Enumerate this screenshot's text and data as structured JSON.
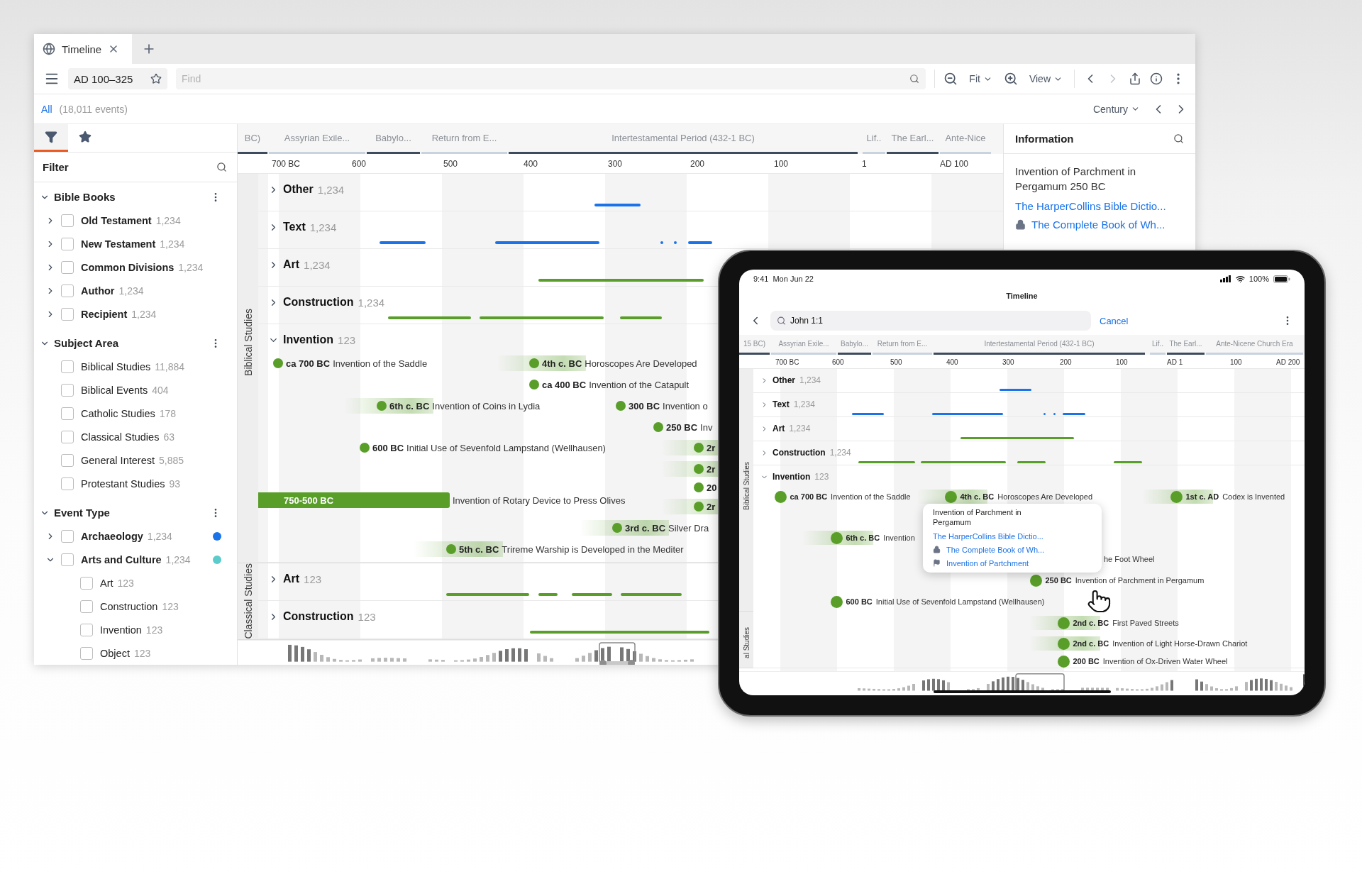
{
  "desktop": {
    "tab": {
      "title": "Timeline"
    },
    "toolbar": {
      "range": "AD 100–325",
      "find_placeholder": "Find",
      "fit": "Fit",
      "view": "View"
    },
    "scope": {
      "filter": "All",
      "count": "(18,011 events)",
      "scale": "Century"
    },
    "sidebar": {
      "tabs": [
        {
          "kind": "filter",
          "selected": true
        },
        {
          "kind": "favorites",
          "selected": false
        }
      ],
      "title": "Filter",
      "sections": [
        {
          "title": "Bible Books",
          "expanded": true,
          "items": [
            {
              "label": "Old Testament",
              "count": "1,234",
              "checked": false,
              "expanded": false
            },
            {
              "label": "New Testament",
              "count": "1,234",
              "checked": false,
              "expanded": false
            },
            {
              "label": "Common Divisions",
              "count": "1,234",
              "checked": false,
              "expanded": false
            },
            {
              "label": "Author",
              "count": "1,234",
              "checked": false,
              "expanded": false
            },
            {
              "label": "Recipient",
              "count": "1,234",
              "checked": false,
              "expanded": false
            }
          ]
        },
        {
          "title": "Subject Area",
          "expanded": true,
          "items": [
            {
              "label": "Biblical Studies",
              "count": "11,884",
              "checked": false
            },
            {
              "label": "Biblical Events",
              "count": "404",
              "checked": false
            },
            {
              "label": "Catholic Studies",
              "count": "178",
              "checked": false
            },
            {
              "label": "Classical Studies",
              "count": "63",
              "checked": false
            },
            {
              "label": "General Interest",
              "count": "5,885",
              "checked": false
            },
            {
              "label": "Protestant Studies",
              "count": "93",
              "checked": false
            }
          ]
        },
        {
          "title": "Event Type",
          "expanded": true,
          "items": [
            {
              "label": "Archaeology",
              "count": "1,234",
              "checked": false,
              "expanded": false,
              "color": "#1a73e8"
            },
            {
              "label": "Arts and Culture",
              "count": "1,234",
              "checked": false,
              "expanded": true,
              "color": "#5ccbcb",
              "children": [
                {
                  "label": "Art",
                  "count": "123",
                  "checked": false
                },
                {
                  "label": "Construction",
                  "count": "123",
                  "checked": false
                },
                {
                  "label": "Invention",
                  "count": "123",
                  "checked": false
                },
                {
                  "label": "Object",
                  "count": "123",
                  "checked": false
                }
              ]
            }
          ]
        }
      ]
    },
    "timeline": {
      "periods": [
        "BC)",
        "Assyrian Exile...",
        "Babylo...",
        "Return from E...",
        "Intertestamental Period (432-1 BC)",
        "Lif..",
        "The Earl...",
        "Ante-Nice"
      ],
      "ticks": [
        "700 BC",
        "600",
        "500",
        "400",
        "300",
        "200",
        "100",
        "1",
        "AD 100"
      ],
      "groups": [
        {
          "label": "Biblical Studies",
          "rows": [
            {
              "label": "Other",
              "count": "1,234",
              "expanded": false,
              "color": "#1a73e8"
            },
            {
              "label": "Text",
              "count": "1,234",
              "expanded": false,
              "color": "#1a73e8"
            },
            {
              "label": "Art",
              "count": "1,234",
              "expanded": false,
              "color": "#5a9e2a"
            },
            {
              "label": "Construction",
              "count": "1,234",
              "expanded": false,
              "color": "#5a9e2a"
            },
            {
              "label": "Invention",
              "count": "123",
              "expanded": true,
              "color": "#5a9e2a",
              "events": [
                {
                  "kind": "point",
                  "date": "ca 700 BC",
                  "title": "Invention of the Saddle"
                },
                {
                  "kind": "fuzzy",
                  "date": "4th c. BC",
                  "title": "Horoscopes Are Developed"
                },
                {
                  "kind": "point",
                  "date": "ca 400 BC",
                  "title": "Invention of the Catapult"
                },
                {
                  "kind": "fuzzy",
                  "date": "6th c. BC",
                  "title": "Invention of Coins in Lydia"
                },
                {
                  "kind": "point",
                  "date": "300 BC",
                  "title": "Invention o"
                },
                {
                  "kind": "point",
                  "date": "250 BC",
                  "title": "Inv"
                },
                {
                  "kind": "point",
                  "date": "600 BC",
                  "title": "Initial Use of Sevenfold Lampstand (Wellhausen)"
                },
                {
                  "kind": "fuzzy",
                  "date": "2r"
                },
                {
                  "kind": "fuzzy",
                  "date": "2r"
                },
                {
                  "kind": "point",
                  "date": "20"
                },
                {
                  "kind": "span",
                  "date": "750-500 BC",
                  "title": "Invention of Rotary Device to Press Olives"
                },
                {
                  "kind": "fuzzy",
                  "date": "2r"
                },
                {
                  "kind": "fuzzy",
                  "date": "3rd c. BC",
                  "title": "Silver Dra"
                },
                {
                  "kind": "fuzzy",
                  "date": "5th c. BC",
                  "title": "Trireme Warship is Developed in the Mediter"
                }
              ]
            }
          ]
        },
        {
          "label": "Classical Studies",
          "rows": [
            {
              "label": "Art",
              "count": "123",
              "expanded": false,
              "color": "#5a9e2a"
            },
            {
              "label": "Construction",
              "count": "123",
              "expanded": false,
              "color": "#5a9e2a"
            }
          ]
        }
      ]
    },
    "information": {
      "title": "Information",
      "event": "Invention of Parchment in Pergamum 250 BC",
      "links": [
        {
          "label": "The HarperCollins Bible Dictio...",
          "kind": "plain"
        },
        {
          "label": "The Complete Book of Wh...",
          "kind": "locked"
        }
      ]
    }
  },
  "tablet": {
    "status": {
      "time": "9:41",
      "date": "Mon Jun 22",
      "battery": "100%"
    },
    "title": "Timeline",
    "search": {
      "value": "John 1:1",
      "cancel": "Cancel"
    },
    "periods": [
      "15 BC)",
      "Assyrian Exile...",
      "Babylo...",
      "Return from E...",
      "Intertestamental Period (432-1 BC)",
      "Lif..",
      "The Earl...",
      "Ante-Nicene Church Era"
    ],
    "ticks": [
      "700 BC",
      "600",
      "500",
      "400",
      "300",
      "200",
      "100",
      "AD 1",
      "100",
      "AD 200"
    ],
    "group_labels": [
      "Biblical Studies",
      "al Studies"
    ],
    "rows": [
      {
        "label": "Other",
        "count": "1,234",
        "expanded": false,
        "color": "#1a73e8"
      },
      {
        "label": "Text",
        "count": "1,234",
        "expanded": false,
        "color": "#1a73e8"
      },
      {
        "label": "Art",
        "count": "1,234",
        "expanded": false,
        "color": "#5a9e2a"
      },
      {
        "label": "Construction",
        "count": "1,234",
        "expanded": false,
        "color": "#5a9e2a"
      },
      {
        "label": "Invention",
        "count": "123",
        "expanded": true,
        "color": "#5a9e2a",
        "events": [
          {
            "kind": "point",
            "date": "ca 700 BC",
            "title": "Invention of the Saddle"
          },
          {
            "kind": "fuzzy",
            "date": "4th c. BC",
            "title": "Horoscopes Are Developed"
          },
          {
            "kind": "fuzzy",
            "date": "1st c. AD",
            "title": "Codex is Invented"
          },
          {
            "kind": "fuzzy",
            "date": "6th c. BC",
            "title": "Invention"
          },
          {
            "kind": "fragment",
            "title": "he Foot Wheel"
          },
          {
            "kind": "point",
            "date": "250 BC",
            "title": "Invention of Parchment in Pergamum"
          },
          {
            "kind": "point",
            "date": "600 BC",
            "title": "Initial Use of Sevenfold Lampstand (Wellhausen)"
          },
          {
            "kind": "fuzzy",
            "date": "2nd c. BC",
            "title": "First Paved Streets"
          },
          {
            "kind": "fuzzy",
            "date": "2nd c. BC",
            "title": "Invention of Light Horse-Drawn Chariot"
          },
          {
            "kind": "point",
            "date": "200 BC",
            "title": "Invention of Ox-Driven Water Wheel"
          }
        ]
      }
    ],
    "popup": {
      "title": "Invention of Parchment in Pergamum",
      "links": [
        {
          "label": "The HarperCollins Bible Dictio...",
          "kind": "plain"
        },
        {
          "label": "The Complete Book of Wh...",
          "kind": "locked"
        },
        {
          "label": "Invention of Partchment",
          "kind": "flag"
        }
      ]
    }
  }
}
